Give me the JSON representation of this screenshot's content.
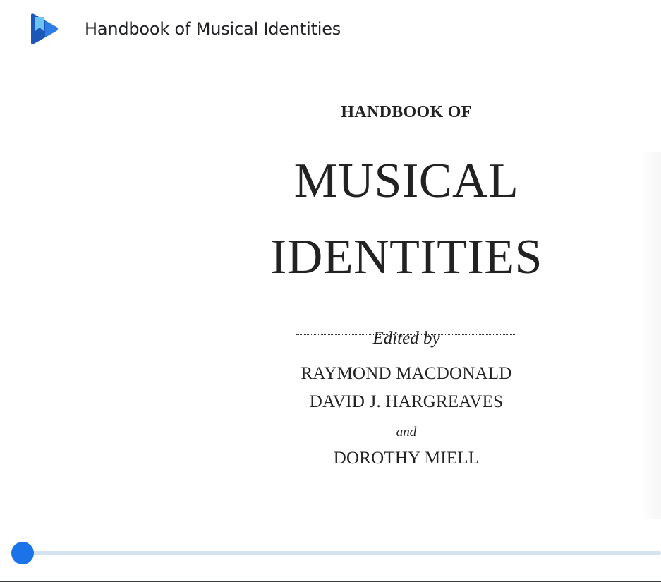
{
  "app": {
    "title": "Handbook of Musical Identities",
    "logo_icon": "google-play-books-icon",
    "colors": {
      "logo_dark": "#1a57b8",
      "logo_mid": "#2e7de6",
      "logo_light": "#6cc3f2",
      "accent": "#1a73e8",
      "track": "#d3e3f0"
    }
  },
  "page": {
    "pre_title": "HANDBOOK OF",
    "title_line_1": "MUSICAL",
    "title_line_2": "IDENTITIES",
    "edited_by": "Edited by",
    "editors": [
      "RAYMOND MACDONALD",
      "DAVID J. HARGREAVES",
      "DOROTHY MIELL"
    ],
    "conjunction": "and"
  },
  "reader": {
    "progress": 0.0
  }
}
